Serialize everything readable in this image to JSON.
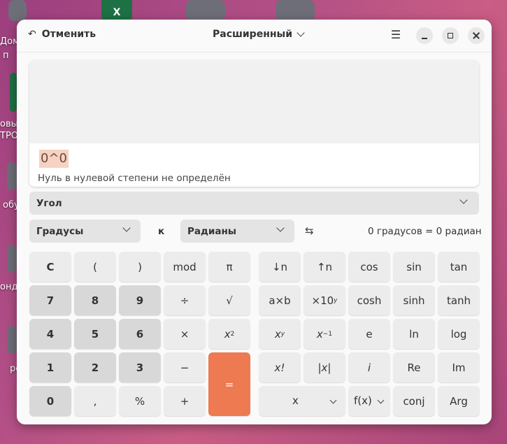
{
  "desktop": {
    "labels": [
      "Дом",
      "п",
      "овы",
      "ТРО",
      "обу",
      "онд",
      "ре"
    ]
  },
  "header": {
    "undo_label": "Отменить",
    "mode_label": "Расширенный",
    "undo_icon": "undo-icon",
    "menu_icon": "hamburger-icon"
  },
  "display": {
    "expression": "0^0",
    "error": "Нуль в нулевой степени не определён"
  },
  "converter": {
    "category": "Угол",
    "from_unit": "Градусы",
    "to_word": "к",
    "to_unit": "Радианы",
    "result": "0 градусов  =  0 радиан"
  },
  "keypad": {
    "basic": {
      "clear": "C",
      "open_paren": "(",
      "close_paren": ")",
      "mod": "mod",
      "pi": "π",
      "d7": "7",
      "d8": "8",
      "d9": "9",
      "divide": "÷",
      "sqrt": "√",
      "d4": "4",
      "d5": "5",
      "d6": "6",
      "multiply": "×",
      "square_base": "x",
      "square_exp": "2",
      "d1": "1",
      "d2": "2",
      "d3": "3",
      "minus": "−",
      "equals": "=",
      "d0": "0",
      "decimal": ",",
      "percent": "%",
      "plus": "+"
    },
    "advanced": {
      "subscript": "↓n",
      "superscript": "↑n",
      "cos": "cos",
      "sin": "sin",
      "tan": "tan",
      "factorize": "a×b",
      "exp10_base": "×10",
      "exp10_exp": "y",
      "cosh": "cosh",
      "sinh": "sinh",
      "tanh": "tanh",
      "power_base": "x",
      "power_exp": "y",
      "inverse_base": "x",
      "inverse_exp": "−1",
      "e": "e",
      "ln": "ln",
      "log": "log",
      "factorial": "x!",
      "abs": "|x|",
      "imag_unit": "i",
      "re": "Re",
      "im": "Im",
      "variable": "x",
      "function": "f(x)",
      "conj": "conj",
      "arg": "Arg"
    }
  },
  "colors": {
    "accent": "#ed7a50",
    "digit_key": "#d8d8d8",
    "key": "#ececec",
    "error_highlight": "#f6d2c2"
  }
}
